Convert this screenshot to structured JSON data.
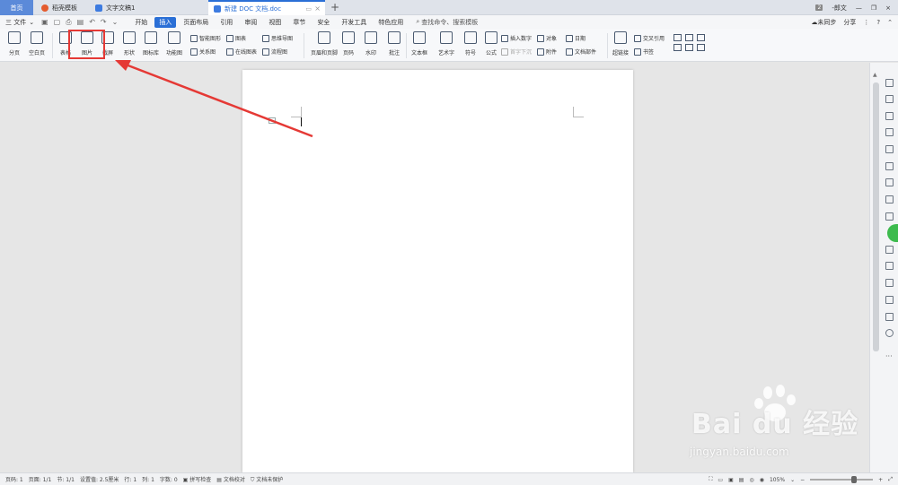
{
  "tabs": {
    "home": "首页",
    "template": "稻壳模板",
    "doc1": "文字文稿1",
    "active": "新建 DOC 文档.doc"
  },
  "title_right": {
    "badge": "2",
    "user": "-郎文"
  },
  "menubar": {
    "file": "三 文件",
    "items": [
      "开始",
      "插入",
      "页面布局",
      "引用",
      "审阅",
      "视图",
      "章节",
      "安全",
      "开发工具",
      "特色应用"
    ],
    "active_index": 1,
    "search": "查找命令、搜索模板",
    "sync": "未同步",
    "share": "分享"
  },
  "ribbon": {
    "page_break": "分页",
    "blank_page": "空白页",
    "table": "表格",
    "picture": "图片",
    "screenshot": "截屏",
    "shape": "形状",
    "icon_lib": "图标库",
    "func_chart": "功能图",
    "smart_graphic": "智能图形",
    "chart": "图表",
    "mind_map": "思维导图",
    "relation": "关系图",
    "online_chart": "在线图表",
    "flow_chart": "流程图",
    "header_footer": "页眉和页脚",
    "page_num": "页码",
    "watermark": "水印",
    "comment": "批注",
    "textbox": "文本框",
    "wordart": "艺术字",
    "symbol": "符号",
    "formula": "公式",
    "insert_num": "插入数字",
    "object": "对象",
    "date": "日期",
    "first_letter": "首字下沉",
    "attachment": "附件",
    "doc_part": "文档部件",
    "hyperlink": "超链接",
    "cross_ref": "交叉引用",
    "bookmark": "书签"
  },
  "status": {
    "page": "页码: 1",
    "pages": "页面: 1/1",
    "section": "节: 1/1",
    "setting": "设置值: 2.5厘米",
    "row": "行: 1",
    "col": "列: 1",
    "words": "字数: 0",
    "spell": "拼写检查",
    "proof": "文档校对",
    "protect": "文档未保护",
    "zoom": "105%"
  },
  "watermark": {
    "logo": "Bai du 经验",
    "url": "jingyan.baidu.com"
  },
  "colors": {
    "accent": "#2a6fd6",
    "highlight": "#e53935"
  }
}
